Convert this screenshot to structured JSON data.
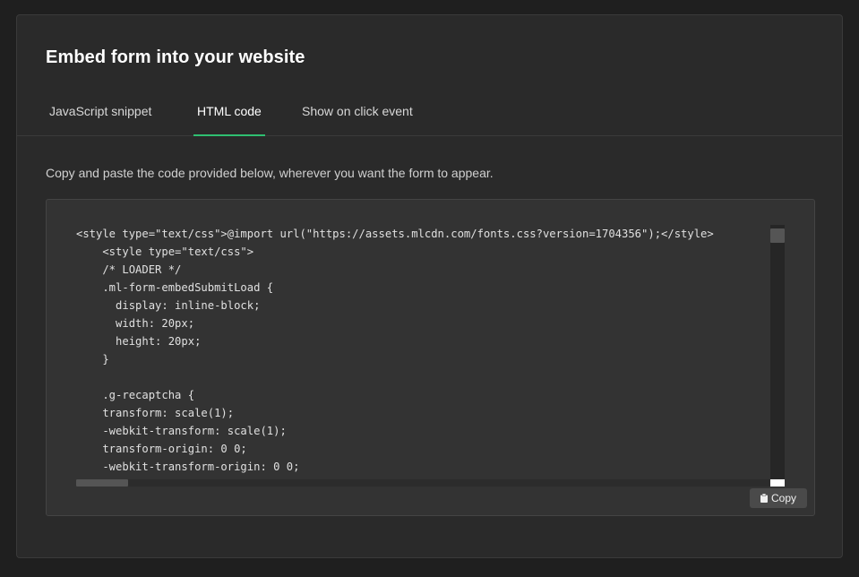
{
  "modal": {
    "title": "Embed form into your website",
    "tabs": [
      {
        "label": "JavaScript snippet",
        "active": false
      },
      {
        "label": "HTML code",
        "active": true
      },
      {
        "label": "Show on click event",
        "active": false
      }
    ],
    "description": "Copy and paste the code provided below, wherever you want the form to appear.",
    "code": {
      "text": "<style type=\"text/css\">@import url(\"https://assets.mlcdn.com/fonts.css?version=1704356\");</style>\n    <style type=\"text/css\">\n    /* LOADER */\n    .ml-form-embedSubmitLoad {\n      display: inline-block;\n      width: 20px;\n      height: 20px;\n    }\n\n    .g-recaptcha {\n    transform: scale(1);\n    -webkit-transform: scale(1);\n    transform-origin: 0 0;\n    -webkit-transform-origin: 0 0;",
      "copy_label": "Copy",
      "copy_icon": "clipboard-icon"
    },
    "colors": {
      "accent": "#2fbf71",
      "background": "#2a2a2a",
      "code_background": "#333333"
    }
  }
}
